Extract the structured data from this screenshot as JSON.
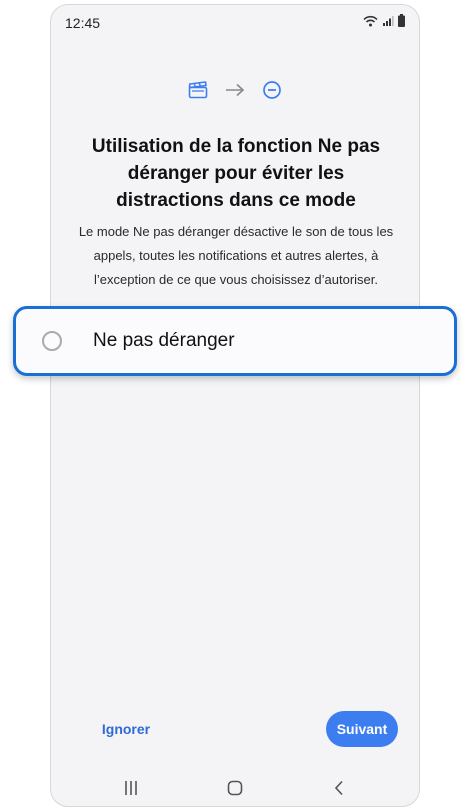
{
  "status_bar": {
    "time": "12:45"
  },
  "icons": {
    "mode": "clapperboard-icon",
    "arrow": "arrow-right-icon",
    "dnd": "do-not-disturb-icon",
    "wifi": "wifi-icon",
    "signal": "signal-icon",
    "battery": "battery-icon"
  },
  "title": "Utilisation de la fonction Ne pas déranger pour éviter les distractions dans ce mode",
  "description": "Le mode Ne pas déranger désactive le son de tous les appels, toutes les notifications et autres alertes, à l’exception de ce que vous choisissez d’autoriser.",
  "option": {
    "label": "Ne pas déranger",
    "selected": false
  },
  "buttons": {
    "skip": "Ignorer",
    "next": "Suivant"
  },
  "nav": [
    "recents-icon",
    "home-icon",
    "back-icon"
  ],
  "colors": {
    "accent": "#3c7ef0",
    "highlight": "#1a6fd6",
    "background": "#f4f4f7"
  }
}
